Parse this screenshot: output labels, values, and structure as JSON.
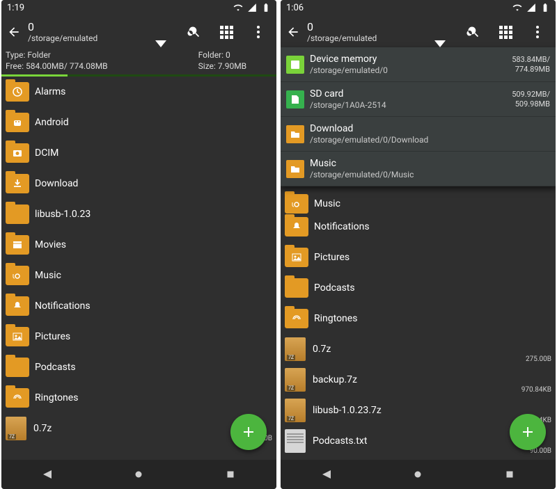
{
  "left": {
    "status": {
      "time": "1:19"
    },
    "appbar": {
      "title": "0",
      "subtitle": "/storage/emulated"
    },
    "info": {
      "type_label": "Type: Folder",
      "free_label": "Free: 584.00MB/ 774.08MB",
      "folder_label": "Folder: 0",
      "size_label": "Size: 7.90MB",
      "usage_pct": 24
    },
    "items": [
      {
        "name": "Alarms",
        "kind": "folder",
        "overlay": "clock",
        "dir": "<DIR>"
      },
      {
        "name": "Android",
        "kind": "folder",
        "overlay": "android",
        "dir": "<DIR>"
      },
      {
        "name": "DCIM",
        "kind": "folder",
        "overlay": "camera",
        "dir": "<DIR>"
      },
      {
        "name": "Download",
        "kind": "folder",
        "overlay": "download",
        "dir": "<DIR>"
      },
      {
        "name": "libusb-1.0.23",
        "kind": "folder",
        "overlay": "",
        "dir": "<DIR>"
      },
      {
        "name": "Movies",
        "kind": "folder",
        "overlay": "movie",
        "dir": "<DIR>"
      },
      {
        "name": "Music",
        "kind": "folder",
        "overlay": "music",
        "dir": "<DIR>"
      },
      {
        "name": "Notifications",
        "kind": "folder",
        "overlay": "bell",
        "dir": "<DIR>"
      },
      {
        "name": "Pictures",
        "kind": "folder",
        "overlay": "picture",
        "dir": "<DIR>"
      },
      {
        "name": "Podcasts",
        "kind": "folder",
        "overlay": "",
        "dir": "<DIR>"
      },
      {
        "name": "Ringtones",
        "kind": "folder",
        "overlay": "ring",
        "dir": "<DIR>"
      },
      {
        "name": "0.7z",
        "kind": "7z",
        "size": "275.00B"
      }
    ]
  },
  "right": {
    "status": {
      "time": "1:06"
    },
    "appbar": {
      "title": "0",
      "subtitle": "/storage/emulated"
    },
    "dropdown": [
      {
        "icon": "device",
        "title": "Device memory",
        "path": "/storage/emulated/0",
        "line1": "583.84MB/",
        "line2": "774.89MB"
      },
      {
        "icon": "sd",
        "title": "SD card",
        "path": "/storage/1A0A-2514",
        "line1": "509.92MB/",
        "line2": "509.98MB"
      },
      {
        "icon": "folder",
        "title": "Download",
        "path": "/storage/emulated/0/Download"
      },
      {
        "icon": "folder",
        "title": "Music",
        "path": "/storage/emulated/0/Music"
      }
    ],
    "items": [
      {
        "name": "Music",
        "kind": "folder",
        "overlay": "music",
        "dir": "<DIR>",
        "partial": true
      },
      {
        "name": "Notifications",
        "kind": "folder",
        "overlay": "bell",
        "dir": "<DIR>"
      },
      {
        "name": "Pictures",
        "kind": "folder",
        "overlay": "picture",
        "dir": "<DIR>"
      },
      {
        "name": "Podcasts",
        "kind": "folder",
        "overlay": "",
        "dir": "<DIR>"
      },
      {
        "name": "Ringtones",
        "kind": "folder",
        "overlay": "ring",
        "dir": "<DIR>"
      },
      {
        "name": "0.7z",
        "kind": "7z",
        "size": "275.00B"
      },
      {
        "name": "backup.7z",
        "kind": "7z",
        "size": "970.84KB"
      },
      {
        "name": "libusb-1.0.23.7z",
        "kind": "7z",
        "size": "1.34KB"
      },
      {
        "name": "Podcasts.txt",
        "kind": "txt",
        "size": "90.00B",
        "partial_bottom": true
      }
    ]
  }
}
